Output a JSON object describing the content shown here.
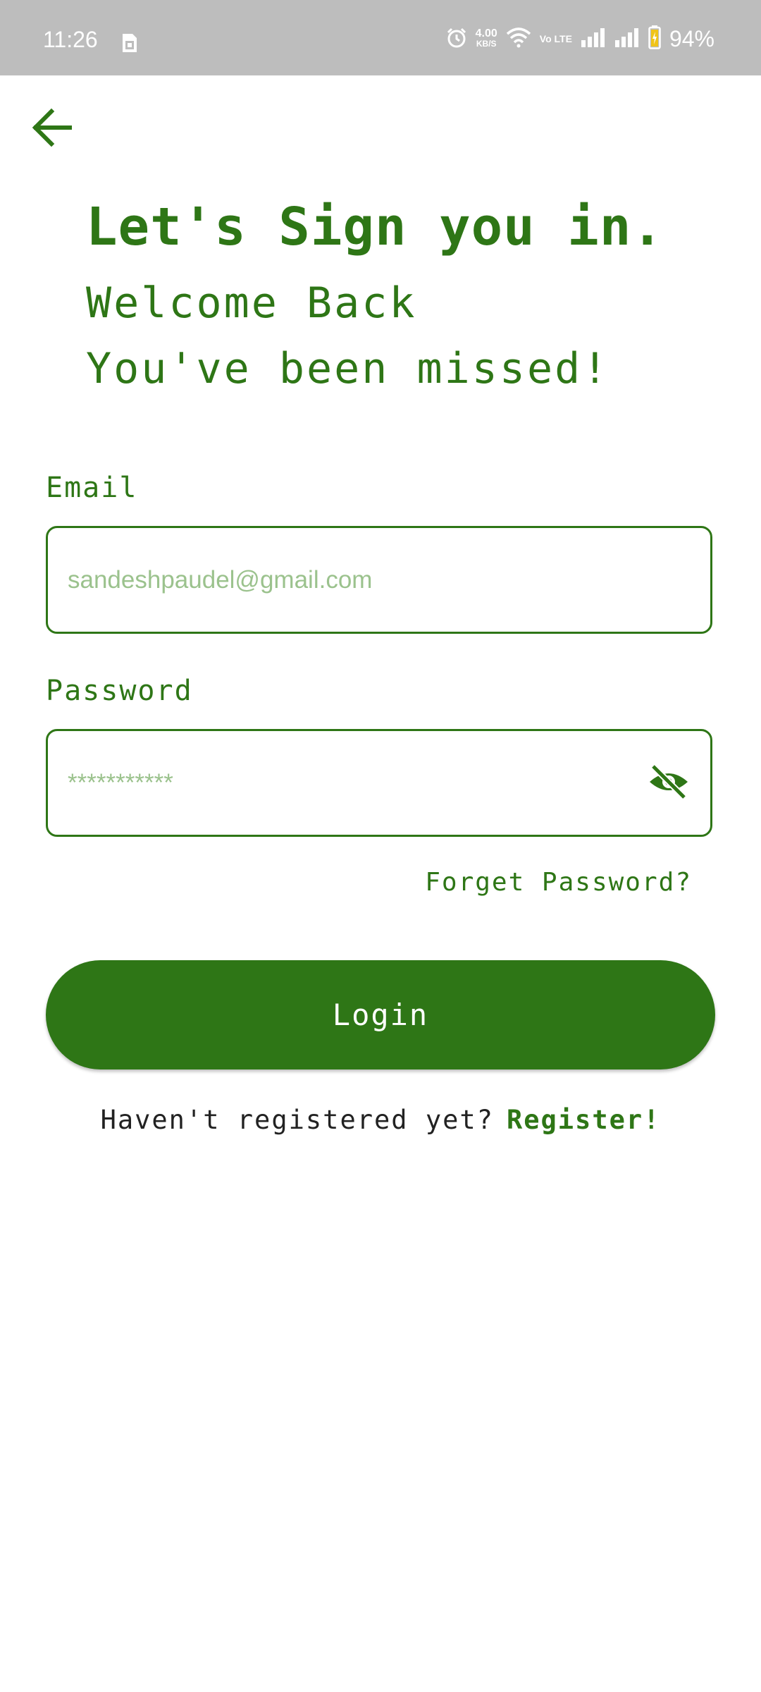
{
  "status_bar": {
    "time": "11:26",
    "network_speed": "4.00",
    "network_speed_unit": "KB/S",
    "volte": "Vo LTE",
    "battery_percent": "94%",
    "icons": [
      "sim-card-icon",
      "alarm-icon",
      "wifi-icon",
      "signal-icon",
      "signal-icon",
      "battery-charging-icon"
    ]
  },
  "header": {
    "back_icon": "arrow-left-icon",
    "title": "Let's Sign you in.",
    "subtitle_line1": "Welcome Back",
    "subtitle_line2": "You've been missed!"
  },
  "form": {
    "email_label": "Email",
    "email_placeholder": "sandeshpaudel@gmail.com",
    "password_label": "Password",
    "password_placeholder": "***********",
    "password_toggle_icon": "eye-off-icon",
    "forget_password": "Forget Password?",
    "login_button": "Login"
  },
  "footer": {
    "register_prompt": "Haven't registered yet?",
    "register_link": "Register!"
  },
  "colors": {
    "primary": "#2e7616",
    "placeholder": "#9bc28d",
    "status_bar_bg": "#bdbdbd",
    "background": "#ffffff"
  }
}
